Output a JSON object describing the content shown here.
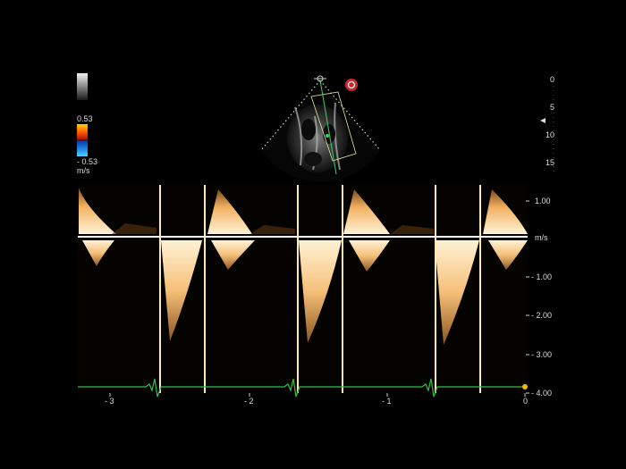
{
  "color_map": {
    "max_label": "0.53",
    "min_label": "- 0.53",
    "unit": "m/s"
  },
  "depth_scale": {
    "ticks": [
      "0",
      "5",
      "10",
      "15"
    ]
  },
  "velocity_scale": {
    "unit": "m/s",
    "ticks": [
      "1.00",
      "- 1.00",
      "- 2.00",
      "- 3.00",
      "- 4.00"
    ]
  },
  "time_axis": {
    "ticks": [
      "- 3",
      "- 2",
      "- 1",
      "0"
    ]
  },
  "colors": {
    "background": "#000000",
    "spectral": "#f7c98a",
    "ecg": "#2fbf4a",
    "baseline": "#ffffff"
  }
}
